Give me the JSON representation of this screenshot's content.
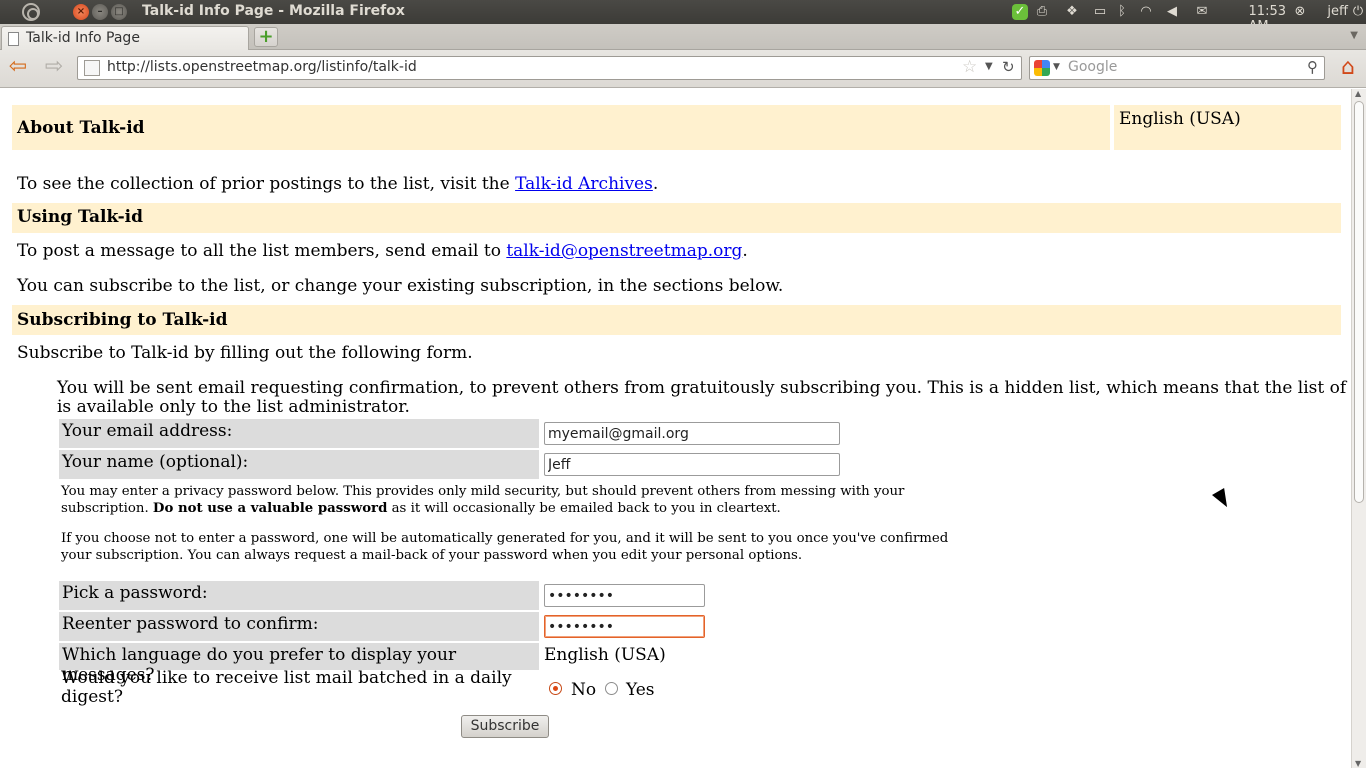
{
  "window": {
    "title": "Talk-id Info Page - Mozilla Firefox",
    "tray": {
      "time": "11:53 AM",
      "user": "jeff"
    }
  },
  "tabs": [
    {
      "label": "Talk-id Info Page"
    }
  ],
  "nav": {
    "url": "http://lists.openstreetmap.org/listinfo/talk-id",
    "search_placeholder": "Google"
  },
  "page": {
    "about_header": "About Talk-id",
    "language_box": "English (USA)",
    "archives_text_before": "To see the collection of prior postings to the list, visit the ",
    "archives_link": "Talk-id Archives",
    "archives_text_after": ".",
    "using_header": "Using Talk-id",
    "post_text_before": "To post a message to all the list members, send email to ",
    "post_email": "talk-id@openstreetmap.org",
    "post_text_after": ".",
    "subscribe_info": "You can subscribe to the list, or change your existing subscription, in the sections below.",
    "subscribing_header": "Subscribing to Talk-id",
    "subscribe_intro": "Subscribe to Talk-id by filling out the following form.",
    "confirm_line1": "You will be sent email requesting confirmation, to prevent others from gratuitously subscribing you. This is a hidden list, which means that the list of members",
    "confirm_line2": "is available only to the list administrator."
  },
  "form": {
    "email_label": "Your email address:",
    "email_value": "myemail@gmail.org",
    "name_label": "Your name (optional):",
    "name_value": "Jeff",
    "privacy_line1": "You may enter a privacy password below. This provides only mild security, but should prevent others from messing with your",
    "privacy_line2_before": "subscription. ",
    "privacy_line2_bold": "Do not use a valuable password",
    "privacy_line2_after": " as it will occasionally be emailed back to you in cleartext.",
    "autogen_line1": "If you choose not to enter a password, one will be automatically generated for you, and it will be sent to you once you've confirmed",
    "autogen_line2": "your subscription. You can always request a mail-back of your password when you edit your personal options.",
    "password_label": "Pick a password:",
    "password_value": "••••••••",
    "confirm_label": "Reenter password to confirm:",
    "confirm_value": "••••••••",
    "language_label": "Which language do you prefer to display your messages?",
    "language_value": "English (USA)",
    "digest_label_line1": "Would you like to receive list mail batched in a daily",
    "digest_label_line2": "digest?",
    "digest_no": "No",
    "digest_yes": "Yes",
    "digest_selected": "No",
    "subscribe_button": "Subscribe"
  },
  "colors": {
    "header_bg": "#fff1cf",
    "label_bg": "#dcdcdc",
    "link": "#0000ee",
    "focus_accent": "#e3632a"
  },
  "icons": [
    "ubuntu-logo-icon",
    "close-icon",
    "minimize-icon",
    "maximize-icon",
    "shield-check-icon",
    "printer-icon",
    "dropbox-icon",
    "display-icon",
    "bluetooth-icon",
    "wifi-icon",
    "volume-icon",
    "mail-icon",
    "power-icon",
    "page-icon",
    "plus-icon",
    "back-arrow-icon",
    "forward-arrow-icon",
    "star-icon",
    "reload-icon",
    "google-icon",
    "search-icon",
    "home-icon",
    "mouse-pointer-icon"
  ]
}
